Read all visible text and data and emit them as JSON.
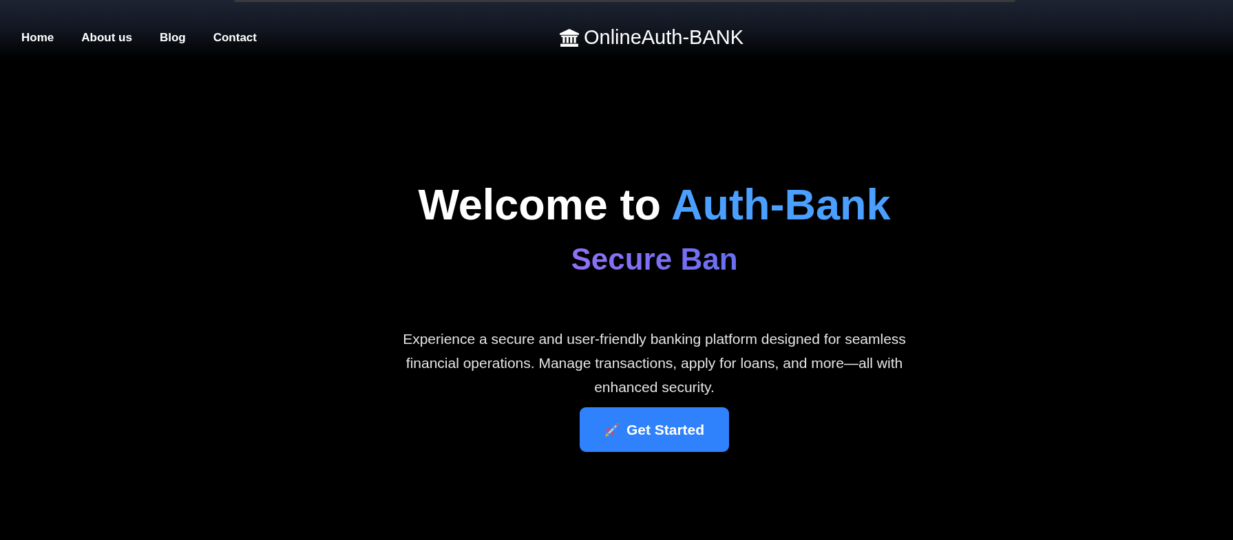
{
  "nav": {
    "links": [
      {
        "label": "Home"
      },
      {
        "label": "About us"
      },
      {
        "label": "Blog"
      },
      {
        "label": "Contact"
      }
    ],
    "brand": {
      "label": "OnlineAuth-BANK"
    }
  },
  "hero": {
    "title_lead": "Welcome to",
    "title_highlight": "Auth-Bank",
    "subtitle": "Secure Ban",
    "description": "Experience a secure and user-friendly banking platform designed for seamless financial operations. Manage transactions, apply for loans, and more—all with enhanced security.",
    "button": {
      "label": "Get Started"
    }
  }
}
